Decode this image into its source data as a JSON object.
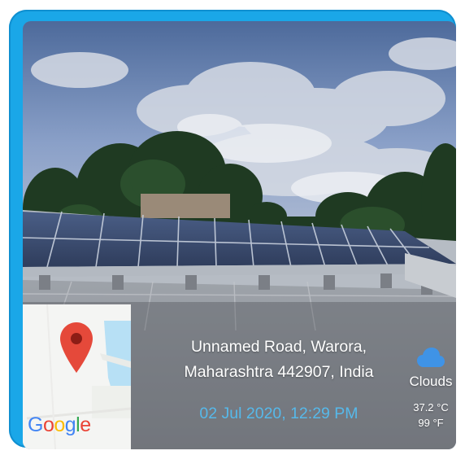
{
  "map": {
    "brand_letters": [
      "G",
      "o",
      "o",
      "g",
      "l",
      "e"
    ],
    "pin_icon": "map-pin-icon"
  },
  "location": {
    "address_line1": "Unnamed Road, Warora,",
    "address_line2": "Maharashtra 442907, India",
    "timestamp": "02 Jul 2020, 12:29 PM"
  },
  "weather": {
    "icon": "cloud-icon",
    "condition": "Clouds",
    "temp_c": "37.2 °C",
    "temp_f": "99 °F"
  },
  "colors": {
    "frame": "#1aa7e8",
    "timestamp": "#56b9ea",
    "cloud_icon": "#3f93e6",
    "pin": "#e5493a"
  }
}
